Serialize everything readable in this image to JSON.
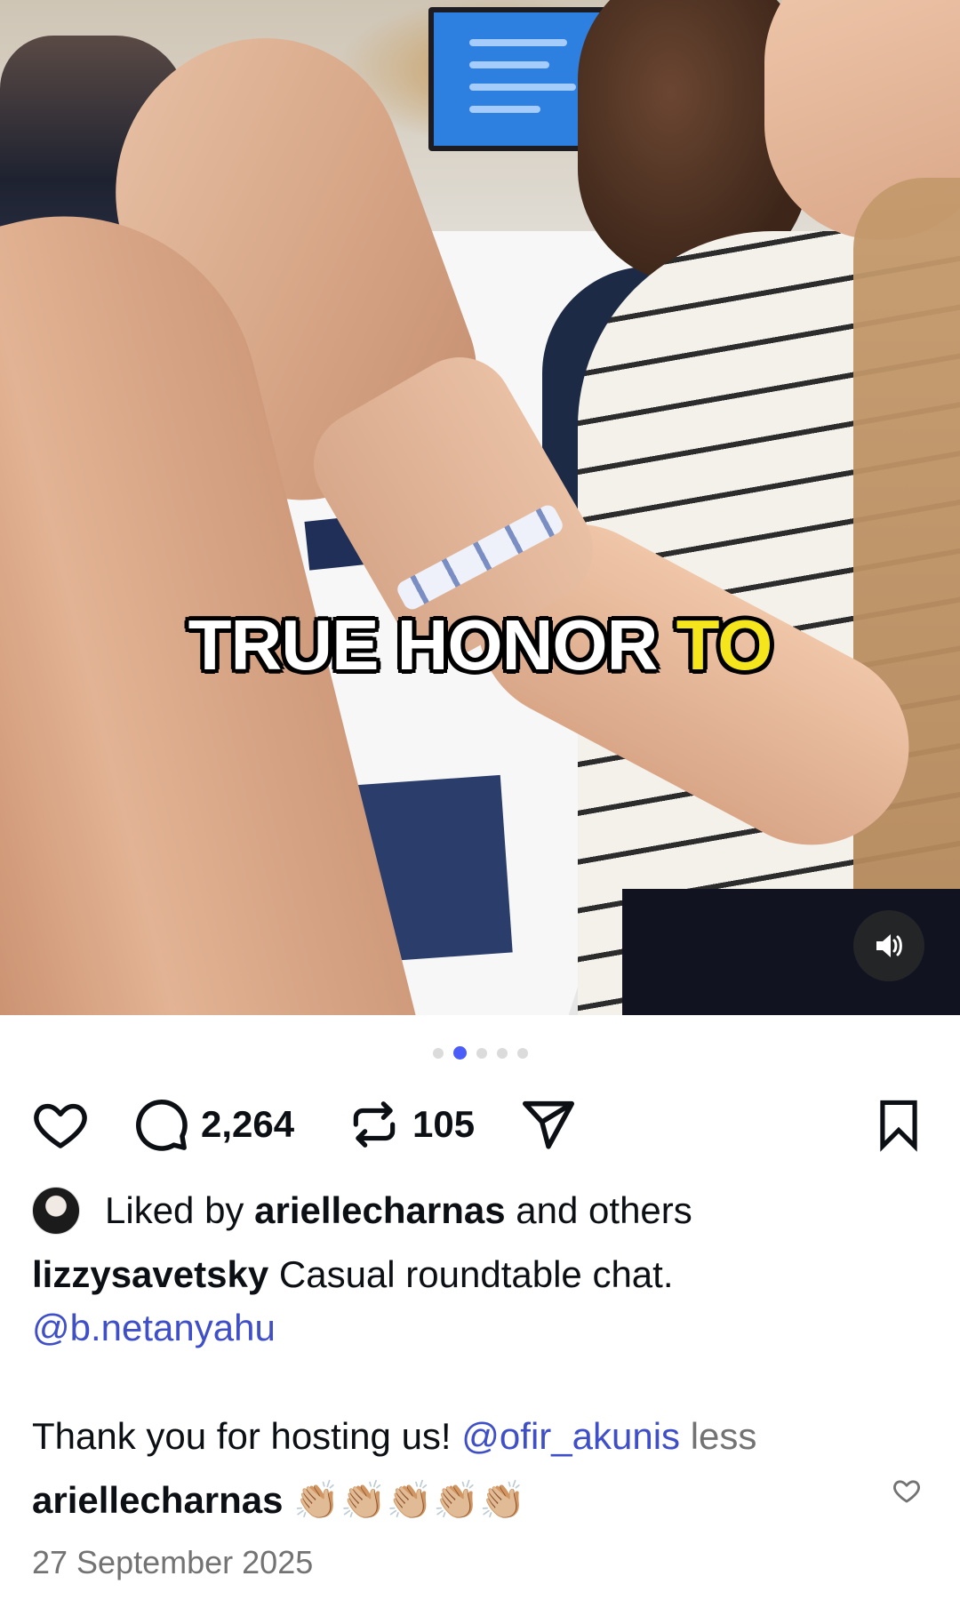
{
  "post": {
    "video_caption": {
      "text_white": "TRUE HONOR",
      "text_yellow": "TO"
    },
    "carousel": {
      "dots_total": 5,
      "active_index": 1
    },
    "actions": {
      "comments_count": "2,264",
      "reposts_count": "105"
    },
    "liked_by": {
      "prefix": "Liked by",
      "user": "ariellecharnas",
      "suffix": "and others"
    },
    "caption": {
      "author": "lizzysavetsky",
      "text": "Casual roundtable chat.",
      "mention1": "@b.netanyahu",
      "text2": "Thank you for hosting us!",
      "mention2": "@ofir_akunis",
      "less": "less"
    },
    "comment": {
      "user": "ariellecharnas",
      "emoji": "👏🏼👏🏼👏🏼👏🏼👏🏼"
    },
    "date": "27 September 2025"
  },
  "colors": {
    "accent": "#4a5df9",
    "link": "#3f4fc7",
    "caption_highlight": "#f4e51c"
  }
}
